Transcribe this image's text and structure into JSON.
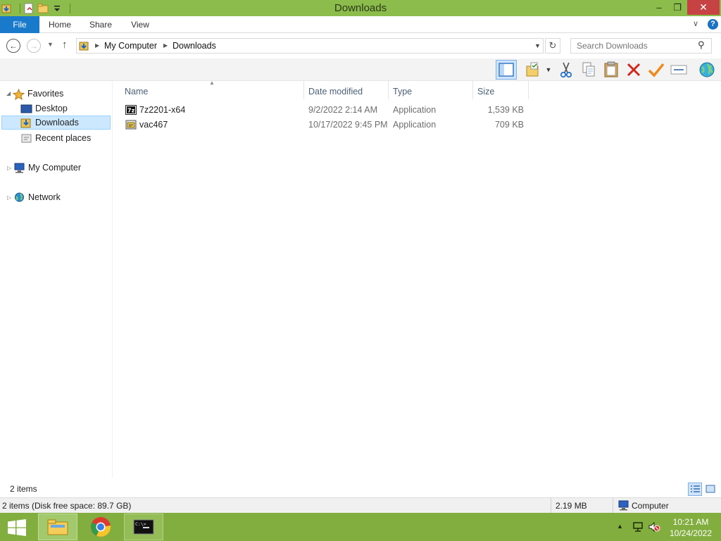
{
  "window": {
    "title": "Downloads",
    "controls": {
      "minimize": "–",
      "maximize": "❐",
      "close": "✕"
    }
  },
  "ribbon": {
    "tabs": [
      {
        "label": "File",
        "active": true
      },
      {
        "label": "Home"
      },
      {
        "label": "Share"
      },
      {
        "label": "View"
      }
    ],
    "help": "?"
  },
  "address": {
    "breadcrumbs": [
      "My Computer",
      "Downloads"
    ],
    "search_placeholder": "Search Downloads"
  },
  "toolbar": {
    "buttons": [
      "preview-pane-icon",
      "open-folder-icon",
      "cut-icon",
      "copy-icon",
      "paste-icon",
      "delete-icon",
      "check-icon",
      "rename-icon",
      "globe-icon"
    ]
  },
  "navpane": {
    "favorites": {
      "label": "Favorites",
      "items": [
        "Desktop",
        "Downloads",
        "Recent places"
      ],
      "selected": "Downloads"
    },
    "computer": "My Computer",
    "network": "Network"
  },
  "filelist": {
    "columns": [
      "Name",
      "Date modified",
      "Type",
      "Size"
    ],
    "rows": [
      {
        "name": "7z2201-x64",
        "date": "9/2/2022 2:14 AM",
        "type": "Application",
        "size": "1,539 KB",
        "icon": "7zip-installer-icon"
      },
      {
        "name": "vac467",
        "date": "10/17/2022 9:45 PM",
        "type": "Application",
        "size": "709 KB",
        "icon": "application-icon"
      }
    ]
  },
  "status": {
    "item_count": "2 items",
    "details_text": "2 items (Disk free space: 89.7 GB)",
    "selection_size": "2.19 MB",
    "location": "Computer"
  },
  "taskbar": {
    "apps": [
      "file-explorer",
      "google-chrome",
      "command-prompt"
    ],
    "time": "10:21 AM",
    "date": "10/24/2022"
  },
  "colors": {
    "titlebar": "#8cbc4c",
    "taskbar": "#81ae3f",
    "file_tab": "#1979ca",
    "close_button": "#c74343",
    "selection": "#cce8ff"
  }
}
